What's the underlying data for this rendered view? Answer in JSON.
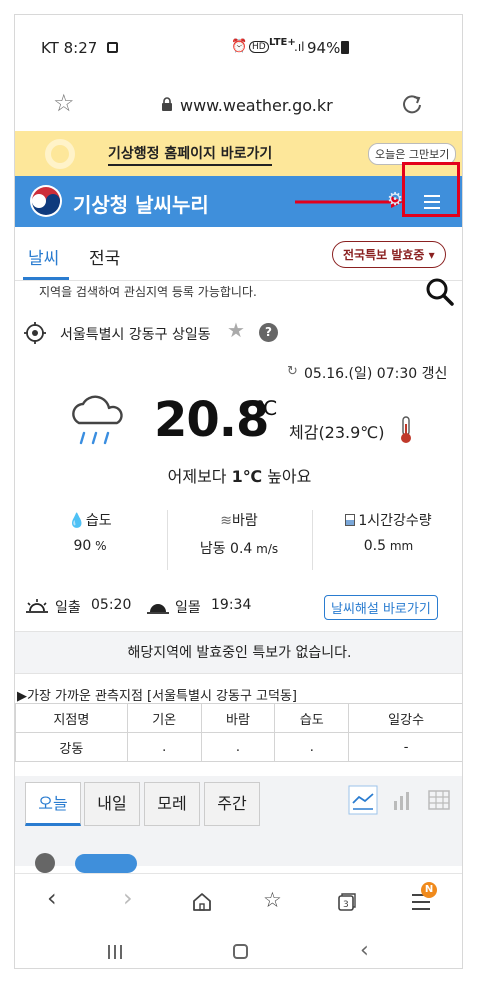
{
  "status_bar": {
    "carrier_time": "KT 8:27",
    "network": "LTE+",
    "battery": "94%"
  },
  "url_bar": {
    "url": "www.weather.go.kr"
  },
  "banner": {
    "link": "기상행정 홈페이지 바로가기",
    "dismiss": "오늘은 그만보기"
  },
  "header": {
    "title": "기상청 날씨누리"
  },
  "tabs": {
    "weather": "날씨",
    "nationwide": "전국",
    "warning_button": "전국특보 발효중 ▾"
  },
  "search": {
    "hint": "지역을 검색하여 관심지역 등록 가능합니다."
  },
  "location": {
    "name": "서울특별시 강동구 상일동",
    "help": "?"
  },
  "current": {
    "updated": "05.16.(일) 07:30 갱신",
    "temperature": "20.8",
    "temp_unit": "℃",
    "feels_like": "체감(23.9℃)",
    "compare_prefix": "어제보다 ",
    "compare_value": "1℃",
    "compare_suffix": " 높아요"
  },
  "metrics": [
    {
      "label": "습도",
      "value": "90",
      "unit": " %"
    },
    {
      "label": "바람",
      "value": "남동 0.4",
      "unit": " m/s"
    },
    {
      "label": "1시간강수량",
      "value": "0.5",
      "unit": " mm"
    }
  ],
  "sun": {
    "sunrise_label": "일출",
    "sunrise": "05:20",
    "sunset_label": "일몰",
    "sunset": "19:34",
    "link": "날씨해설 바로가기"
  },
  "notice": "해당지역에 발효중인 특보가 없습니다.",
  "observation": {
    "title": "▶가장 가까운 관측지점 [서울특별시 강동구 고덕동]",
    "headers": [
      "지점명",
      "기온",
      "바람",
      "습도",
      "일강수"
    ],
    "row": [
      "강동",
      ".",
      ".",
      ".",
      "-"
    ]
  },
  "forecast_tabs": [
    "오늘",
    "내일",
    "모레",
    "주간"
  ],
  "nav": {
    "badge": "N"
  },
  "colors": {
    "header_blue": "#3f8fdb",
    "banner_yellow": "#fde79a",
    "highlight_red": "#e3001b"
  }
}
